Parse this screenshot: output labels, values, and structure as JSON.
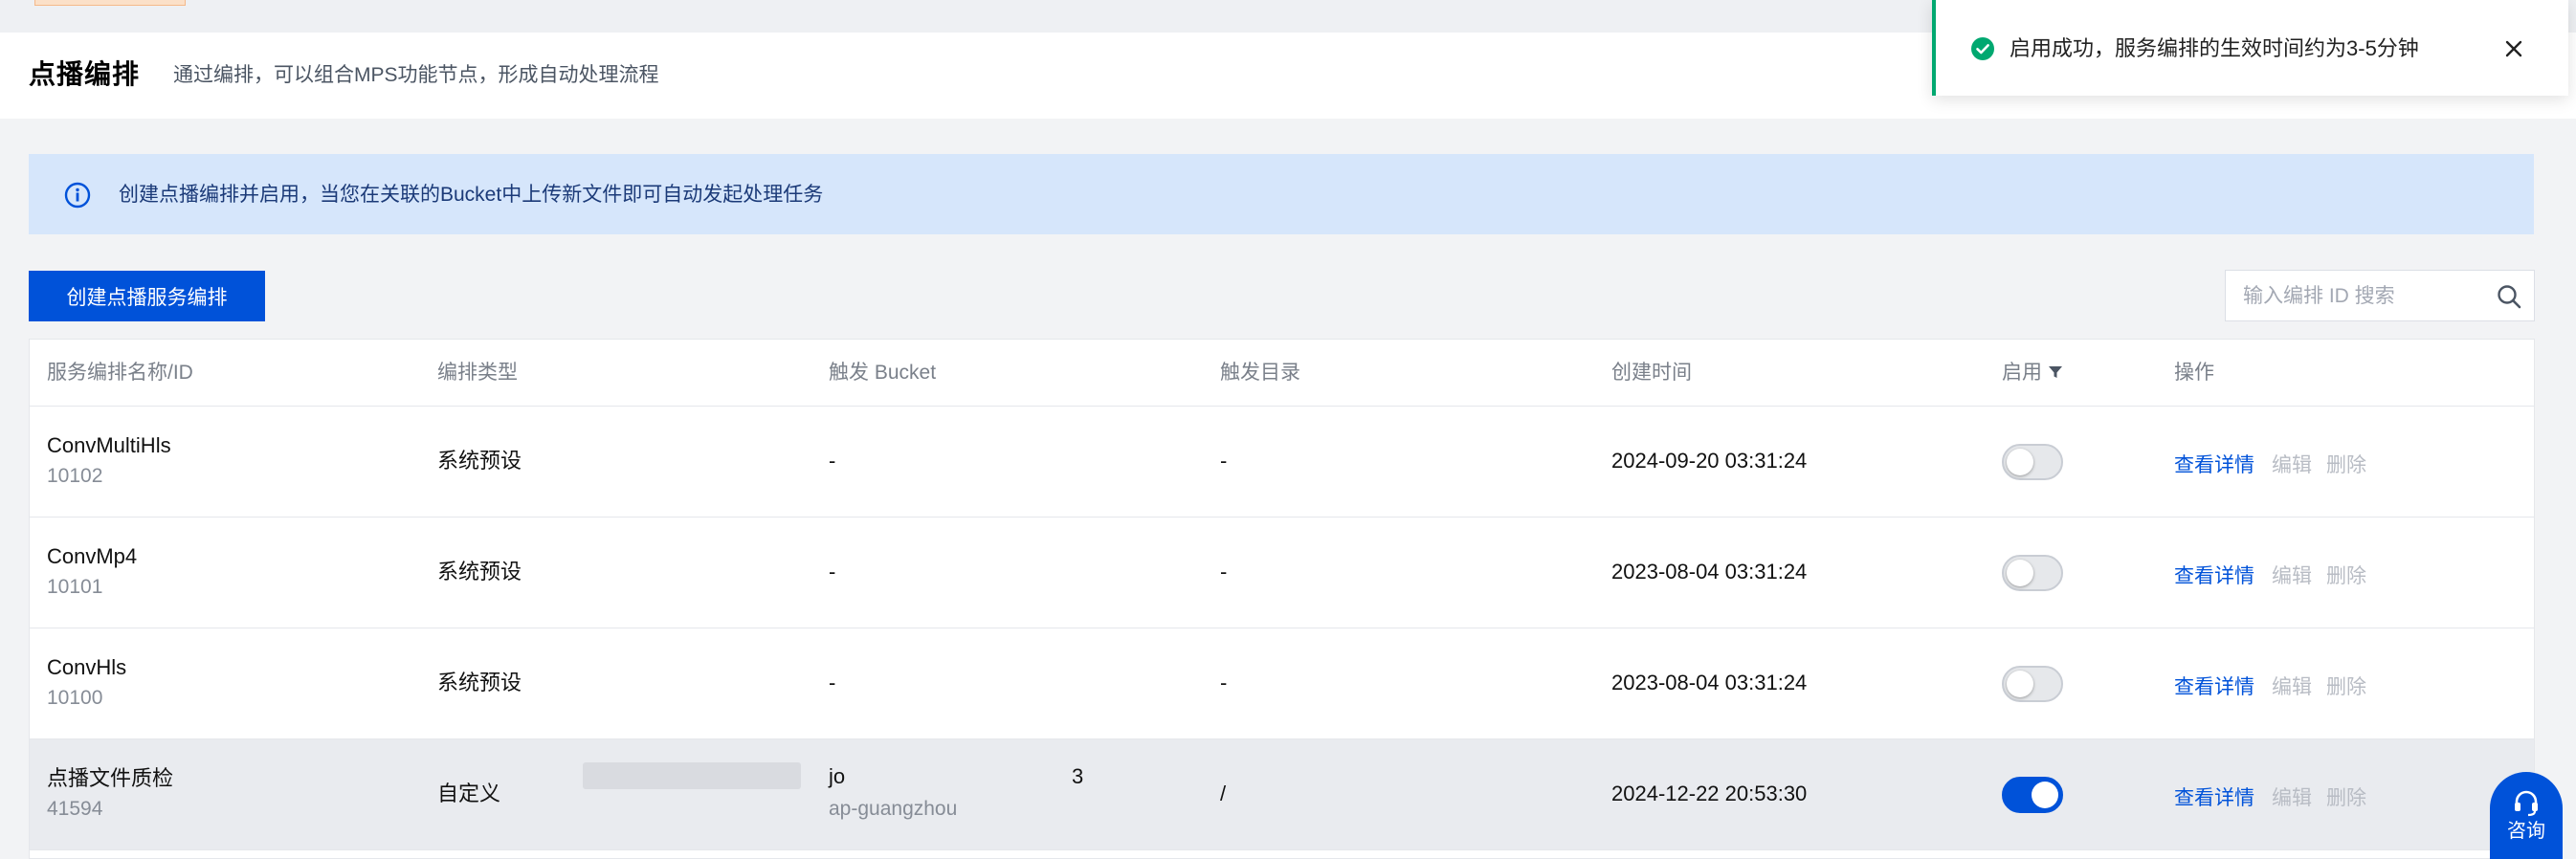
{
  "header": {
    "title": "点播编排",
    "subtitle": "通过编排，可以组合MPS功能节点，形成自动处理流程"
  },
  "alert": {
    "text": "创建点播编排并启用，当您在关联的Bucket中上传新文件即可自动发起处理任务"
  },
  "toolbar": {
    "create_label": "创建点播服务编排",
    "search_placeholder": "输入编排 ID 搜索"
  },
  "table": {
    "columns": [
      "服务编排名称/ID",
      "编排类型",
      "触发 Bucket",
      "触发目录",
      "创建时间",
      "启用",
      "操作"
    ],
    "rows": [
      {
        "name": "ConvMultiHls",
        "id": "10102",
        "type": "系统预设",
        "bucket": "-",
        "bucket_region": "",
        "dir": "-",
        "created": "2024-09-20 03:31:24",
        "enabled": false
      },
      {
        "name": "ConvMp4",
        "id": "10101",
        "type": "系统预设",
        "bucket": "-",
        "bucket_region": "",
        "dir": "-",
        "created": "2023-08-04 03:31:24",
        "enabled": false
      },
      {
        "name": "ConvHls",
        "id": "10100",
        "type": "系统预设",
        "bucket": "-",
        "bucket_region": "",
        "dir": "-",
        "created": "2023-08-04 03:31:24",
        "enabled": false
      },
      {
        "name": "点播文件质检",
        "id": "41594",
        "type": "自定义",
        "bucket_prefix": "jo",
        "bucket_suffix": "3",
        "bucket_region": "ap-guangzhou",
        "dir": "/",
        "created": "2024-12-22 20:53:30",
        "enabled": true
      }
    ],
    "actions": {
      "view": "查看详情",
      "edit": "编辑",
      "delete": "删除"
    }
  },
  "toast": {
    "text": "启用成功，服务编排的生效时间约为3-5分钟"
  },
  "consult": {
    "label": "咨询"
  },
  "colors": {
    "primary": "#0052d9",
    "success": "#00a870",
    "alert_bg": "#d6e6fb",
    "disabled_text": "#b8bcc4"
  }
}
